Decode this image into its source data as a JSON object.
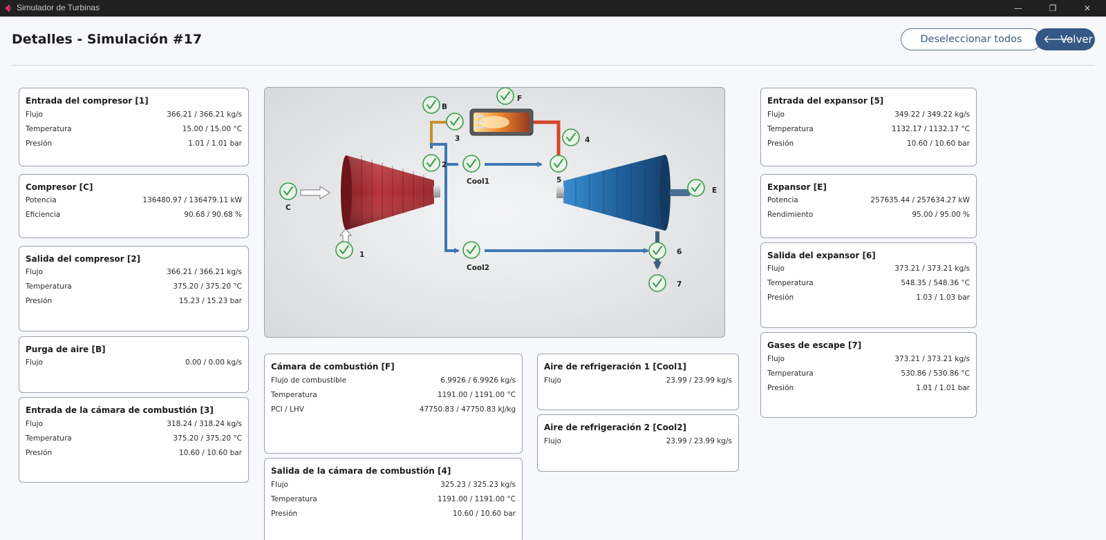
{
  "app": {
    "title": "Simulador de Turbinas"
  },
  "window_controls": {
    "minimize": "—",
    "maximize": "❐",
    "close": "✕"
  },
  "header": {
    "title": "Detalles - Simulación #17",
    "deselect_label": "Deseleccionar todos",
    "back_label": "Volver",
    "back_icon": "arrow-left-icon"
  },
  "cards": [
    {
      "title": "Entrada del compresor [1]",
      "rows": [
        {
          "label": "Flujo",
          "value": "366.21 / 366.21 kg/s"
        },
        {
          "label": "Temperatura",
          "value": "15.00 / 15.00 °C"
        },
        {
          "label": "Presión",
          "value": "1.01 / 1.01 bar"
        }
      ]
    },
    {
      "title": "Compresor [C]",
      "rows": [
        {
          "label": "Potencia",
          "value": "136480.97 / 136479.11 kW"
        },
        {
          "label": "Eficiencia",
          "value": "90.68 / 90.68 %"
        }
      ]
    },
    {
      "title": "Salida del compresor [2]",
      "rows": [
        {
          "label": "Flujo",
          "value": "366.21 / 366.21 kg/s"
        },
        {
          "label": "Temperatura",
          "value": "375.20 / 375.20 °C"
        },
        {
          "label": "Presión",
          "value": "15.23 / 15.23 bar"
        }
      ]
    },
    {
      "title": "Purga de aire [B]",
      "rows": [
        {
          "label": "Flujo",
          "value": "0.00 / 0.00 kg/s"
        }
      ]
    },
    {
      "title": "Entrada de la cámara de combustión [3]",
      "rows": [
        {
          "label": "Flujo",
          "value": "318.24 / 318.24 kg/s"
        },
        {
          "label": "Temperatura",
          "value": "375.20 / 375.20 °C"
        },
        {
          "label": "Presión",
          "value": "10.60 / 10.60 bar"
        }
      ]
    },
    {
      "title": "Cámara de combustión [F]",
      "rows": [
        {
          "label": "Flujo de combustible",
          "value": "6.9926 / 6.9926 kg/s"
        },
        {
          "label": "Temperatura",
          "value": "1191.00 / 1191.00 °C"
        },
        {
          "label": "PCI / LHV",
          "value": "47750.83 / 47750.83 kJ/kg"
        }
      ]
    },
    {
      "title": "Salida de la cámara de combustión [4]",
      "rows": [
        {
          "label": "Flujo",
          "value": "325.23 / 325.23 kg/s"
        },
        {
          "label": "Temperatura",
          "value": "1191.00 / 1191.00 °C"
        },
        {
          "label": "Presión",
          "value": "10.60 / 10.60 bar"
        }
      ]
    },
    {
      "title": "Aire de refrigeración 1 [Cool1]",
      "rows": [
        {
          "label": "Flujo",
          "value": "23.99 / 23.99 kg/s"
        }
      ]
    },
    {
      "title": "Aire de refrigeración 2 [Cool2]",
      "rows": [
        {
          "label": "Flujo",
          "value": "23.99 / 23.99 kg/s"
        }
      ]
    },
    {
      "title": "Entrada del expansor [5]",
      "rows": [
        {
          "label": "Flujo",
          "value": "349.22 / 349.22 kg/s"
        },
        {
          "label": "Temperatura",
          "value": "1132.17 / 1132.17 °C"
        },
        {
          "label": "Presión",
          "value": "10.60 / 10.60 bar"
        }
      ]
    },
    {
      "title": "Expansor [E]",
      "rows": [
        {
          "label": "Potencia",
          "value": "257635.44 / 257634.27 kW"
        },
        {
          "label": "Rendimiento",
          "value": "95.00 / 95.00 %"
        }
      ]
    },
    {
      "title": "Salida del expansor [6]",
      "rows": [
        {
          "label": "Flujo",
          "value": "373.21 / 373.21 kg/s"
        },
        {
          "label": "Temperatura",
          "value": "548.35 / 548.36 °C"
        },
        {
          "label": "Presión",
          "value": "1.03 / 1.03 bar"
        }
      ]
    },
    {
      "title": "Gases de escape [7]",
      "rows": [
        {
          "label": "Flujo",
          "value": "373.21 / 373.21 kg/s"
        },
        {
          "label": "Temperatura",
          "value": "530.86 / 530.86 °C"
        },
        {
          "label": "Presión",
          "value": "1.01 / 1.01 bar"
        }
      ]
    }
  ],
  "diagram": {
    "labels": {
      "C": "C",
      "1": "1",
      "2": "2",
      "B": "B",
      "3": "3",
      "F": "F",
      "4": "4",
      "5": "5",
      "E": "E",
      "6": "6",
      "7": "7",
      "cool1": "Cool1",
      "cool2": "Cool2"
    },
    "selected": {
      "C": true,
      "1": true,
      "2": true,
      "B": true,
      "3": true,
      "F": true,
      "4": true,
      "5": true,
      "E": true,
      "6": true,
      "7": true,
      "cool1": true,
      "cool2": true
    },
    "colors": {
      "compressor": "#a3292b",
      "expander": "#1f5f9b",
      "air": "#3d79b5",
      "bleed": "#c8902e",
      "hot": "#d6452a",
      "exhaust": "#3f5f80",
      "check": "#3c9a4a"
    }
  }
}
